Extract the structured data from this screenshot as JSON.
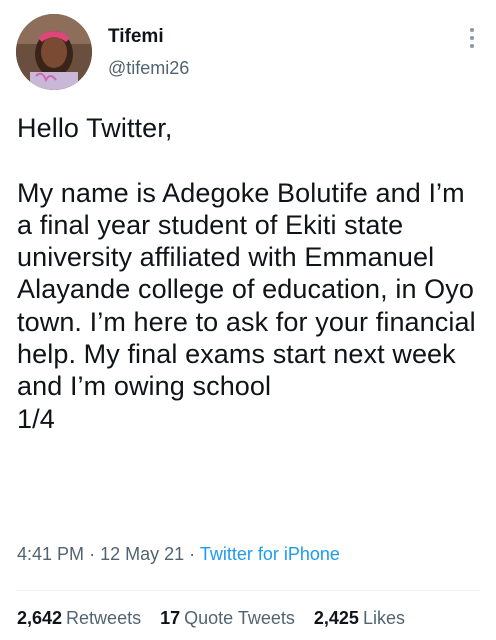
{
  "author": {
    "name": "Tifemi",
    "handle": "@tifemi26"
  },
  "icons": {
    "more": "more-vertical-icon",
    "avatar": "profile-photo"
  },
  "tweet": {
    "text": "Hello Twitter,\n\nMy name is Adegoke Bolutife and I’m a final year student of Ekiti state university affiliated with Emmanuel Alayande college of education, in Oyo town. I’m here to ask for your financial help. My final exams start next week and I’m owing school\n1/4",
    "time": "4:41 PM",
    "separator": "·",
    "date": "12 May 21",
    "source": "Twitter for iPhone"
  },
  "stats": {
    "retweets_count": "2,642",
    "retweets_label": "Retweets",
    "quotes_count": "17",
    "quotes_label": "Quote Tweets",
    "likes_count": "2,425",
    "likes_label": "Likes"
  },
  "colors": {
    "text": "#0f1419",
    "secondary": "#536471",
    "link": "#1d9bf0",
    "divider": "#eff3f4"
  }
}
